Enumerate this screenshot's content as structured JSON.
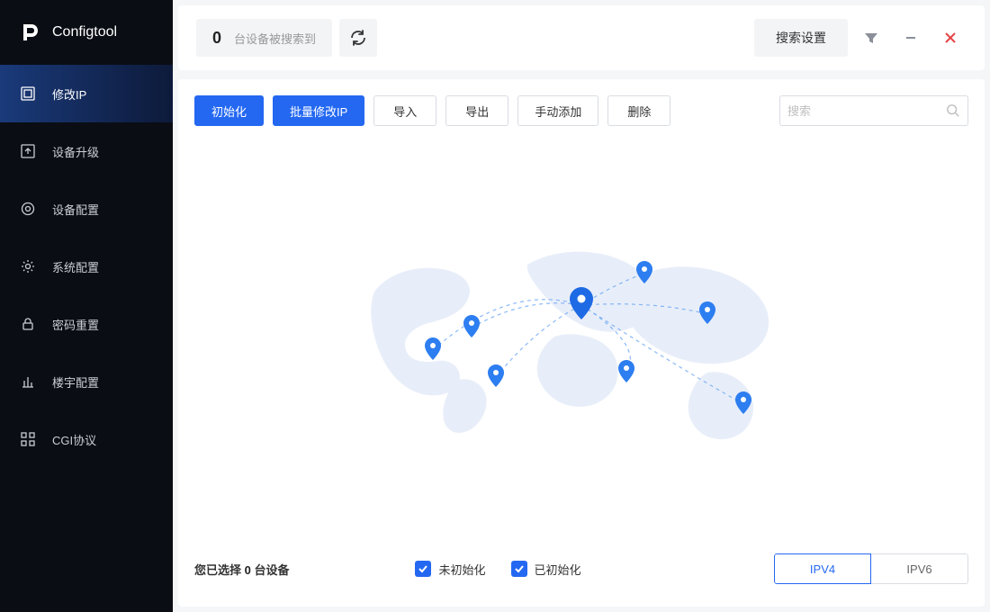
{
  "app": {
    "name": "Configtool"
  },
  "sidebar": {
    "items": [
      {
        "label": "修改IP"
      },
      {
        "label": "设备升级"
      },
      {
        "label": "设备配置"
      },
      {
        "label": "系统配置"
      },
      {
        "label": "密码重置"
      },
      {
        "label": "楼宇配置"
      },
      {
        "label": "CGI协议"
      }
    ]
  },
  "topbar": {
    "count": "0",
    "count_label": "台设备被搜索到",
    "search_settings": "搜索设置"
  },
  "toolbar": {
    "init": "初始化",
    "batch_ip": "批量修改IP",
    "import": "导入",
    "export": "导出",
    "manual_add": "手动添加",
    "delete": "删除",
    "search_placeholder": "搜索"
  },
  "footer": {
    "sel_prefix": "您已选择 ",
    "sel_count": "0",
    "sel_suffix": " 台设备",
    "uninit": "未初始化",
    "inited": "已初始化",
    "ipv4": "IPV4",
    "ipv6": "IPV6"
  }
}
